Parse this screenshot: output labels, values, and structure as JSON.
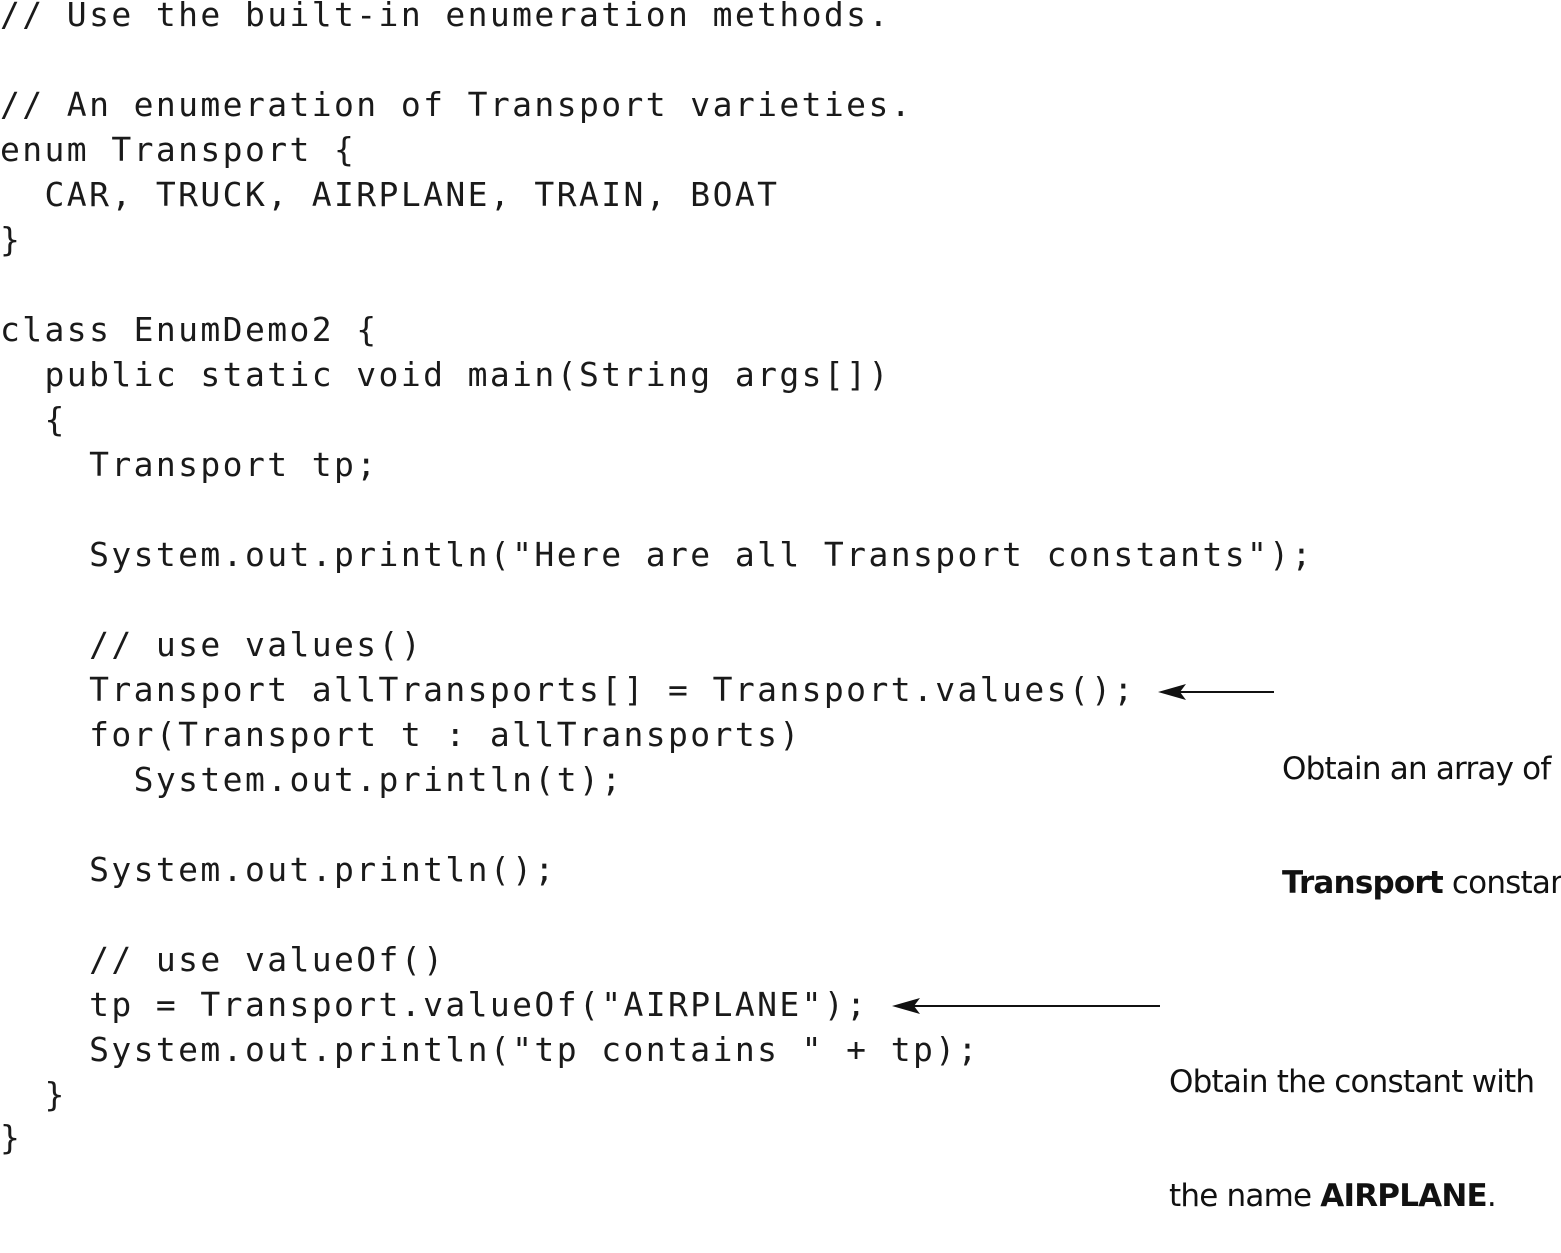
{
  "code_lines": [
    "// Use the built-in enumeration methods.",
    "",
    "// An enumeration of Transport varieties.",
    "enum Transport {",
    "  CAR, TRUCK, AIRPLANE, TRAIN, BOAT",
    "}",
    "",
    "class EnumDemo2 {",
    "  public static void main(String args[])",
    "  {",
    "    Transport tp;",
    "",
    "    System.out.println(\"Here are all Transport constants\");",
    "",
    "    // use values()",
    "    Transport allTransports[] = Transport.values();",
    "    for(Transport t : allTransports)",
    "      System.out.println(t);",
    "",
    "    System.out.println();",
    "",
    "    // use valueOf()",
    "    tp = Transport.valueOf(\"AIRPLANE\");",
    "    System.out.println(\"tp contains \" + tp);",
    "  }",
    "}"
  ],
  "annotations": {
    "values": {
      "line1": "Obtain an array of",
      "line2_bold": "Transport",
      "line2_rest": " constants."
    },
    "valueOf": {
      "line1": "Obtain the constant with",
      "line2_pre": "the name ",
      "line2_bold": "AIRPLANE",
      "line2_post": "."
    }
  }
}
